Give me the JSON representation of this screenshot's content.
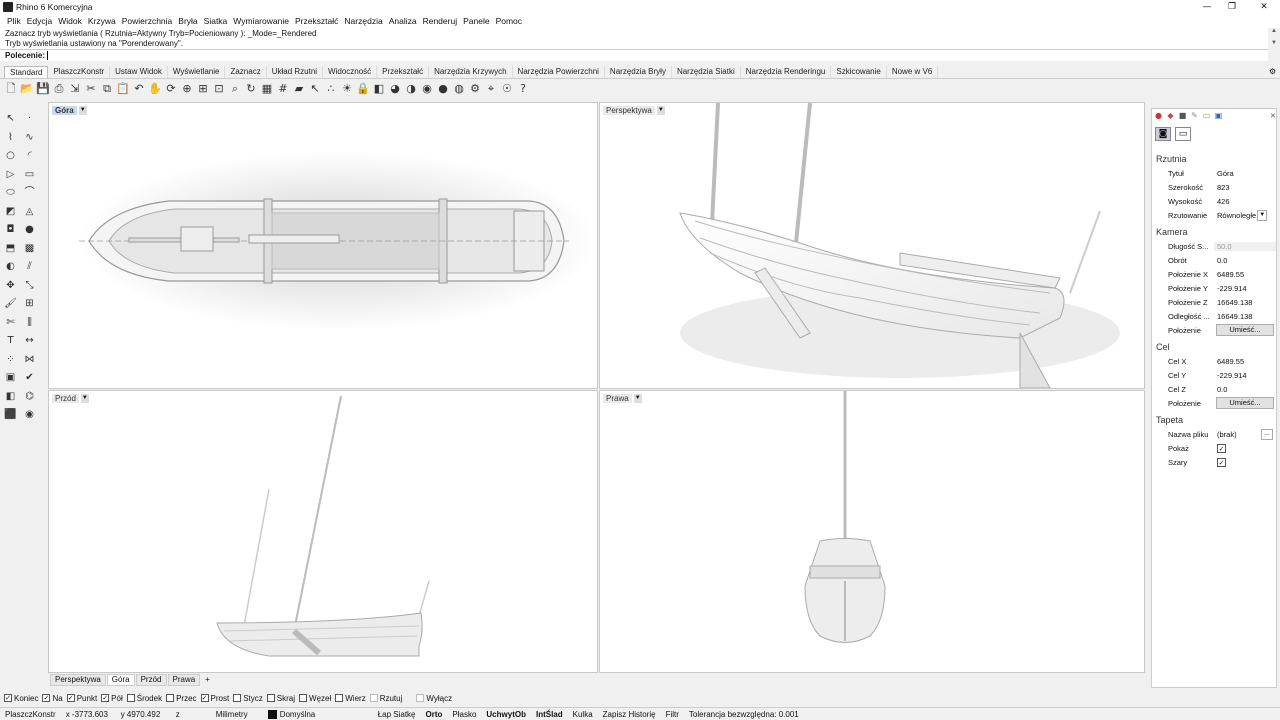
{
  "window": {
    "title": "Rhino 6 Komercyjna",
    "min": "—",
    "max": "❐",
    "close": "✕"
  },
  "menu": [
    "Plik",
    "Edycja",
    "Widok",
    "Krzywa",
    "Powierzchnia",
    "Bryła",
    "Siatka",
    "Wymiarowanie",
    "Przekształć",
    "Narzędzia",
    "Analiza",
    "Renderuj",
    "Panele",
    "Pomoc"
  ],
  "history": {
    "line1": "Zaznacz tryb wyświetlania ( Rzutnia=Aktywny  Tryb=Pocieniowany ): _Mode=_Rendered",
    "line2": "Tryb wyświetlania ustawiony na \"Porenderowany\"."
  },
  "command": {
    "label": "Polecenie:",
    "value": ""
  },
  "tabs": [
    "Standard",
    "PlaszczKonstr",
    "Ustaw Widok",
    "Wyświetlanie",
    "Zaznacz",
    "Układ Rzutni",
    "Widoczność",
    "Przekształć",
    "Narzędzia Krzywych",
    "Narzędzia Powierzchni",
    "Narzędzia Bryły",
    "Narzędzia Siatki",
    "Narzędzia Renderingu",
    "Szkicowanie",
    "Nowe w V6"
  ],
  "toolbar_icons": [
    "new-icon",
    "open-icon",
    "save-icon",
    "print-icon",
    "import-icon",
    "cut-icon",
    "copy-icon",
    "paste-icon",
    "undo-icon",
    "pan-icon",
    "rotate-icon",
    "zoom-in-icon",
    "zoom-window-icon",
    "zoom-extents-icon",
    "zoom-selected-icon",
    "rotate-view-icon",
    "four-view-icon",
    "grid-icon",
    "car-icon",
    "select-icon",
    "points-icon",
    "light-icon",
    "lock-icon",
    "layer-icon",
    "color-icon",
    "shade-icon",
    "render-icon",
    "sphere-icon",
    "globe-icon",
    "options-icon",
    "snap-icon",
    "web-icon",
    "help-icon"
  ],
  "left_icons": [
    "select-icon",
    "point-icon",
    "polyline-icon",
    "curve-icon",
    "circle-icon",
    "arc-icon",
    "polygon-icon",
    "rectangle-icon",
    "ellipse-icon",
    "fillet-icon",
    "surface-icon",
    "loft-icon",
    "box-icon",
    "sphere-icon",
    "extrude-icon",
    "mesh-icon",
    "boolean-icon",
    "offset-icon",
    "move-icon",
    "scale-icon",
    "paint-icon",
    "group-icon",
    "trim-icon",
    "split-icon",
    "text-icon",
    "dimension-icon",
    "array-icon",
    "join-icon",
    "block-icon",
    "check-icon",
    "layer-icon",
    "analyze-icon",
    "solid-icon",
    "render-icon"
  ],
  "viewports": {
    "top": {
      "name": "Góra"
    },
    "perspective": {
      "name": "Perspektywa"
    },
    "front": {
      "name": "Przód"
    },
    "right": {
      "name": "Prawa"
    }
  },
  "viewport_tabs": [
    "Perspektywa",
    "Góra",
    "Przód",
    "Prawa"
  ],
  "viewport_tab_add": "+",
  "osnaps": [
    {
      "label": "Koniec",
      "checked": true
    },
    {
      "label": "Na",
      "checked": true
    },
    {
      "label": "Punkt",
      "checked": true
    },
    {
      "label": "Pół",
      "checked": true
    },
    {
      "label": "Środek",
      "checked": false
    },
    {
      "label": "Przec",
      "checked": false
    },
    {
      "label": "Prost",
      "checked": true
    },
    {
      "label": "Stycz",
      "checked": false
    },
    {
      "label": "Skraj",
      "checked": false
    },
    {
      "label": "Węzeł",
      "checked": false
    },
    {
      "label": "Wierz",
      "checked": false
    },
    {
      "label": "Rzutuj",
      "checked": false
    },
    {
      "label": "Wyłącz",
      "checked": false
    }
  ],
  "status": {
    "plane": "PlaszczKonstr",
    "x": "x -3773.603",
    "y": "y 4970.492",
    "z": "z",
    "units": "Milimetry",
    "layer_color": "#111111",
    "layer": "Domyślna",
    "items": [
      {
        "label": "Łap Siatkę",
        "bold": false
      },
      {
        "label": "Orto",
        "bold": true
      },
      {
        "label": "Płasko",
        "bold": false
      },
      {
        "label": "UchwytOb",
        "bold": true
      },
      {
        "label": "IntŚlad",
        "bold": true
      },
      {
        "label": "Kulka",
        "bold": false
      },
      {
        "label": "Zapisz Historię",
        "bold": false
      },
      {
        "label": "Filtr",
        "bold": false
      }
    ],
    "tolerance": "Tolerancja bezwzględna: 0.001"
  },
  "props": {
    "section_viewport": "Rzutnia",
    "title_k": "Tytuł",
    "title_v": "Góra",
    "width_k": "Szerokość",
    "width_v": "823",
    "height_k": "Wysokość",
    "height_v": "426",
    "proj_k": "Rzutowanie",
    "proj_v": "Równoległe",
    "section_camera": "Kamera",
    "lens_k": "Długość S...",
    "lens_v": "50.0",
    "rot_k": "Obrót",
    "rot_v": "0.0",
    "px_k": "Położenie X",
    "px_v": "6489.55",
    "py_k": "Położenie Y",
    "py_v": "-229.914",
    "pz_k": "Położenie Z",
    "pz_v": "16649.138",
    "dist_k": "Odległość ...",
    "dist_v": "16649.138",
    "pos_k": "Położenie",
    "place_btn": "Umieść...",
    "section_target": "Cel",
    "tx_k": "Cel X",
    "tx_v": "6489.55",
    "ty_k": "Cel Y",
    "ty_v": "-229.914",
    "tz_k": "Cel Z",
    "tz_v": "0.0",
    "tpos_k": "Położenie",
    "tplace_btn": "Umieść...",
    "section_wallpaper": "Tapeta",
    "file_k": "Nazwa pliku",
    "file_v": "(brak)",
    "file_btn": "...",
    "show_k": "Pokaż",
    "gray_k": "Szary"
  }
}
